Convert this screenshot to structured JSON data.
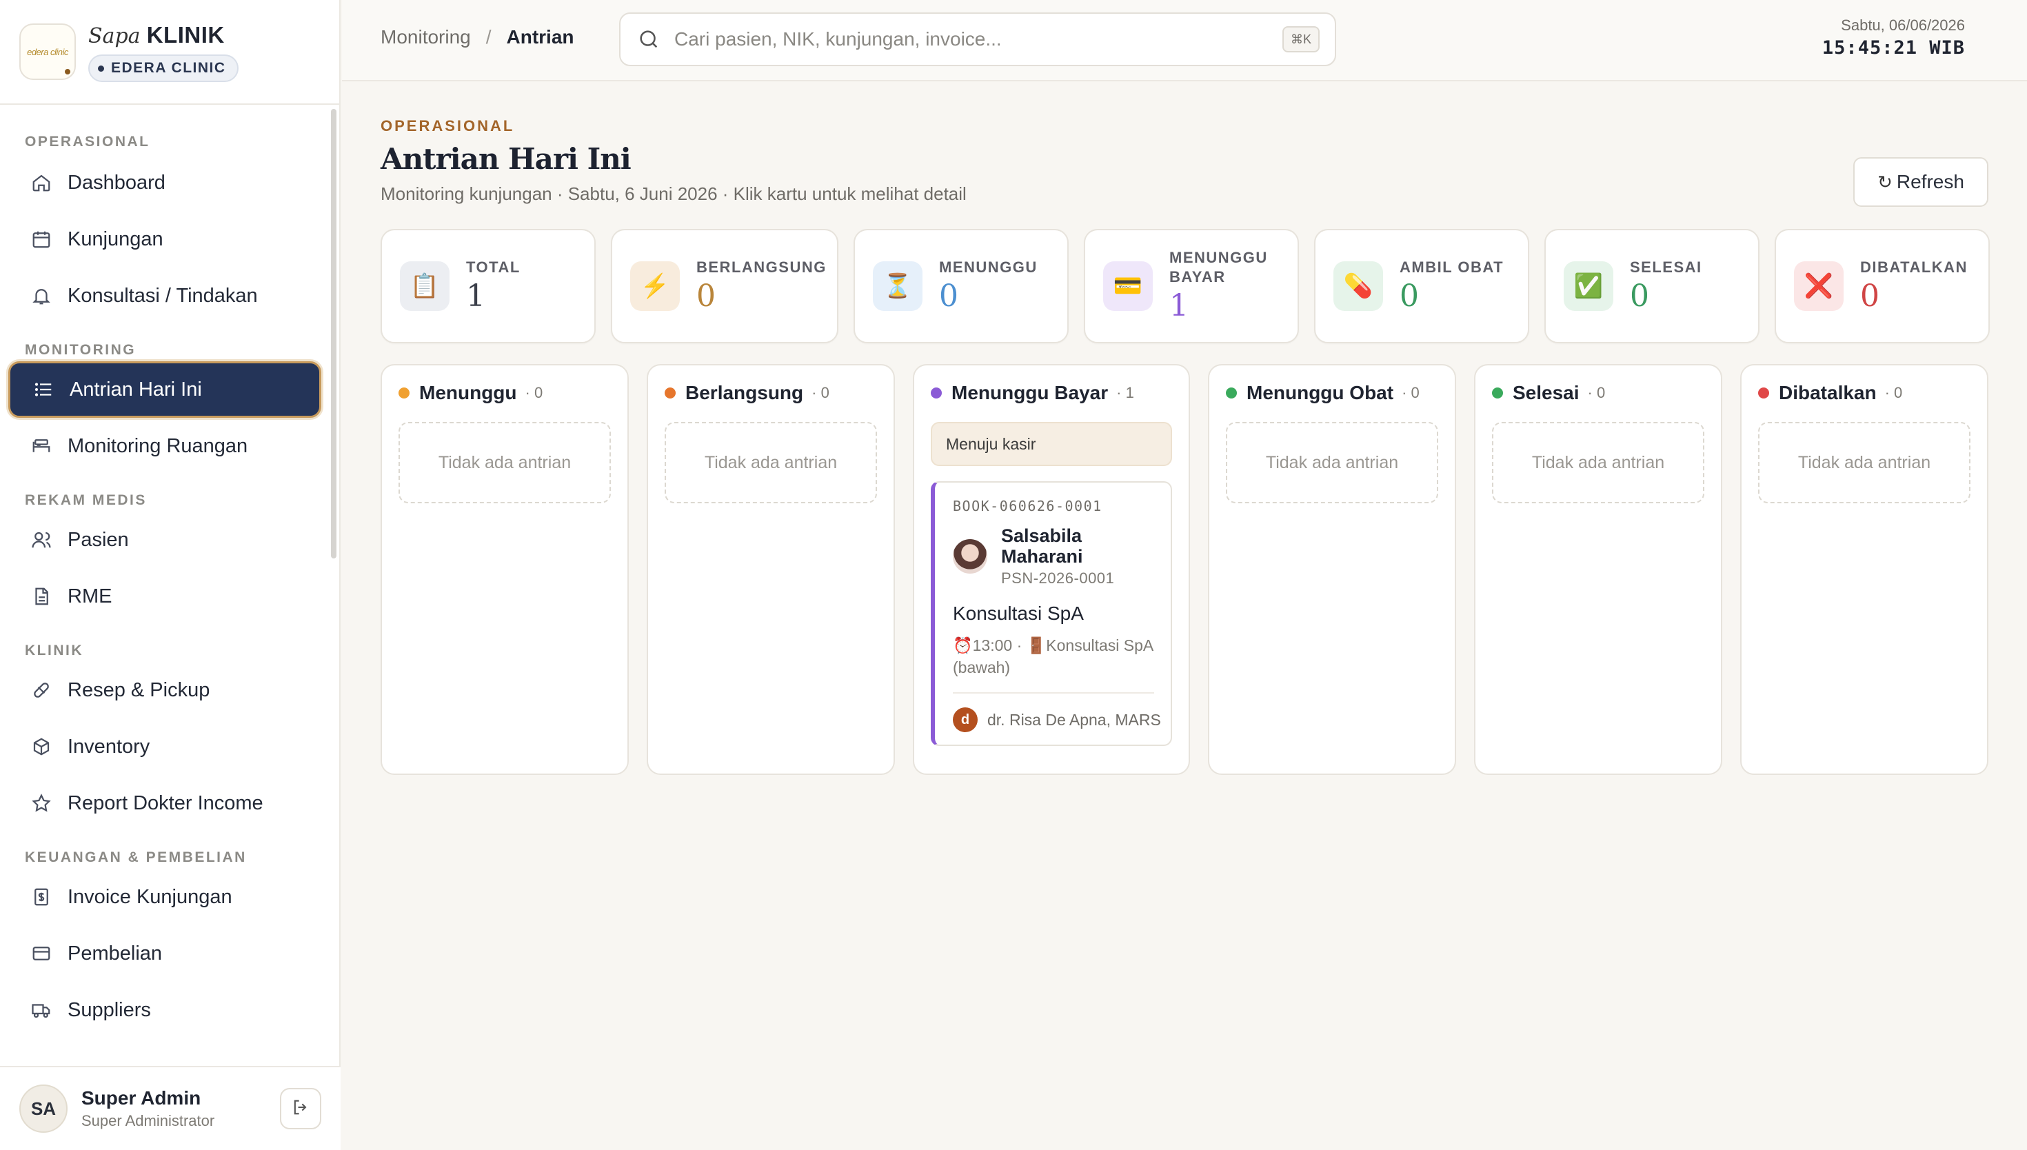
{
  "brand": {
    "logo_text": "edera clinic",
    "name_prefix": "Sapa",
    "name_main": "KLINIK",
    "clinic": "EDERA CLINIC"
  },
  "sidebar": {
    "sections": [
      {
        "title": "OPERASIONAL",
        "items": [
          {
            "label": "Dashboard",
            "icon": "home-icon"
          },
          {
            "label": "Kunjungan",
            "icon": "calendar-icon"
          },
          {
            "label": "Konsultasi / Tindakan",
            "icon": "bell-icon"
          }
        ]
      },
      {
        "title": "MONITORING",
        "items": [
          {
            "label": "Antrian Hari Ini",
            "icon": "list-icon",
            "active": true
          },
          {
            "label": "Monitoring Ruangan",
            "icon": "bed-icon"
          }
        ]
      },
      {
        "title": "REKAM MEDIS",
        "items": [
          {
            "label": "Pasien",
            "icon": "users-icon"
          },
          {
            "label": "RME",
            "icon": "document-icon"
          }
        ]
      },
      {
        "title": "KLINIK",
        "items": [
          {
            "label": "Resep & Pickup",
            "icon": "pill-icon"
          },
          {
            "label": "Inventory",
            "icon": "box-icon"
          },
          {
            "label": "Report Dokter Income",
            "icon": "star-icon"
          }
        ]
      },
      {
        "title": "KEUANGAN & PEMBELIAN",
        "items": [
          {
            "label": "Invoice Kunjungan",
            "icon": "invoice-icon"
          },
          {
            "label": "Pembelian",
            "icon": "card-icon"
          },
          {
            "label": "Suppliers",
            "icon": "truck-icon"
          }
        ]
      }
    ]
  },
  "user": {
    "initials": "SA",
    "name": "Super Admin",
    "role": "Super Administrator"
  },
  "topbar": {
    "breadcrumb": [
      "Monitoring",
      "Antrian"
    ],
    "search_placeholder": "Cari pasien, NIK, kunjungan, invoice...",
    "shortcut": "⌘K",
    "date": "Sabtu, 06/06/2026",
    "time": "15:45:21 WIB"
  },
  "page": {
    "eyebrow": "OPERASIONAL",
    "title": "Antrian Hari Ini",
    "subtitle": "Monitoring kunjungan · Sabtu, 6 Juni 2026 · Klik kartu untuk melihat detail",
    "refresh_label": "Refresh"
  },
  "stats": [
    {
      "label": "TOTAL",
      "value": "1",
      "icon": "📋",
      "icon_name": "clipboard-icon",
      "color": "#3b3f4a",
      "icon_bg": "#eceef2"
    },
    {
      "label": "BERLANGSUNG",
      "value": "0",
      "icon": "⚡",
      "icon_name": "lightning-icon",
      "color": "#b9853a",
      "icon_bg": "#f8ecdd"
    },
    {
      "label": "MENUNGGU",
      "value": "0",
      "icon": "⏳",
      "icon_name": "hourglass-icon",
      "color": "#4c8fd0",
      "icon_bg": "#e6f0fa"
    },
    {
      "label": "MENUNGGU BAYAR",
      "value": "1",
      "icon": "💳",
      "icon_name": "credit-card-icon",
      "color": "#8b5bd6",
      "icon_bg": "#efe7fa"
    },
    {
      "label": "AMBIL OBAT",
      "value": "0",
      "icon": "💊",
      "icon_name": "pill-icon",
      "color": "#3a9a60",
      "icon_bg": "#e6f4ea"
    },
    {
      "label": "SELESAI",
      "value": "0",
      "icon": "✅",
      "icon_name": "check-icon",
      "color": "#3a9a60",
      "icon_bg": "#e6f4ea"
    },
    {
      "label": "DIBATALKAN",
      "value": "0",
      "icon": "❌",
      "icon_name": "cross-icon",
      "color": "#d04545",
      "icon_bg": "#fbe6e6"
    }
  ],
  "columns": [
    {
      "title": "Menunggu",
      "count": "· 0",
      "color": "#f0a030",
      "empty": "Tidak ada antrian"
    },
    {
      "title": "Berlangsung",
      "count": "· 0",
      "color": "#e6762c",
      "empty": "Tidak ada antrian"
    },
    {
      "title": "Menunggu Bayar",
      "count": "· 1",
      "color": "#8b5bd6"
    },
    {
      "title": "Menunggu Obat",
      "count": "· 0",
      "color": "#3aaa5c",
      "empty": "Tidak ada antrian"
    },
    {
      "title": "Selesai",
      "count": "· 0",
      "color": "#3aaa5c",
      "empty": "Tidak ada antrian"
    },
    {
      "title": "Dibatalkan",
      "count": "· 0",
      "color": "#e04848",
      "empty": "Tidak ada antrian"
    }
  ],
  "queue_card": {
    "group_label": "Menuju kasir",
    "booking_code": "BOOK-060626-0001",
    "patient_name": "Salsabila Maharani",
    "patient_id": "PSN-2026-0001",
    "service": "Konsultasi SpA",
    "time": "⏰13:00",
    "room": "🚪Konsultasi SpA (bawah)",
    "doctor_initial": "d",
    "doctor_name": "dr. Risa De Apna, MARS"
  }
}
